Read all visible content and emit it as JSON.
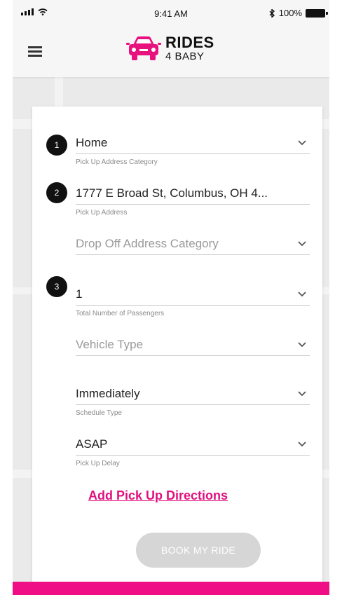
{
  "status_bar": {
    "time": "9:41 AM",
    "battery": "100%"
  },
  "brand": {
    "line1": "RIDES",
    "line2": "4 BABY",
    "color": "#e8127f"
  },
  "steps": [
    "1",
    "2",
    "3"
  ],
  "form": {
    "pickup_category": {
      "value": "Home",
      "hint": "Pick Up Address Category"
    },
    "pickup_address": {
      "value": "1777 E Broad St, Columbus, OH 4...",
      "hint": "Pick Up Address"
    },
    "dropoff_category": {
      "placeholder": "Drop Off Address Category"
    },
    "passengers": {
      "value": "1",
      "hint": "Total Number of Passengers"
    },
    "vehicle_type": {
      "placeholder": "Vehicle Type"
    },
    "schedule_type": {
      "value": "Immediately",
      "hint": "Schedule Type"
    },
    "pickup_delay": {
      "value": "ASAP",
      "hint": "Pick Up Delay"
    }
  },
  "add_directions_link": "Add Pick Up Directions",
  "book_button": "BOOK MY RIDE",
  "colors": {
    "accent": "#e8127f",
    "button_disabled": "#d6d6d6"
  }
}
